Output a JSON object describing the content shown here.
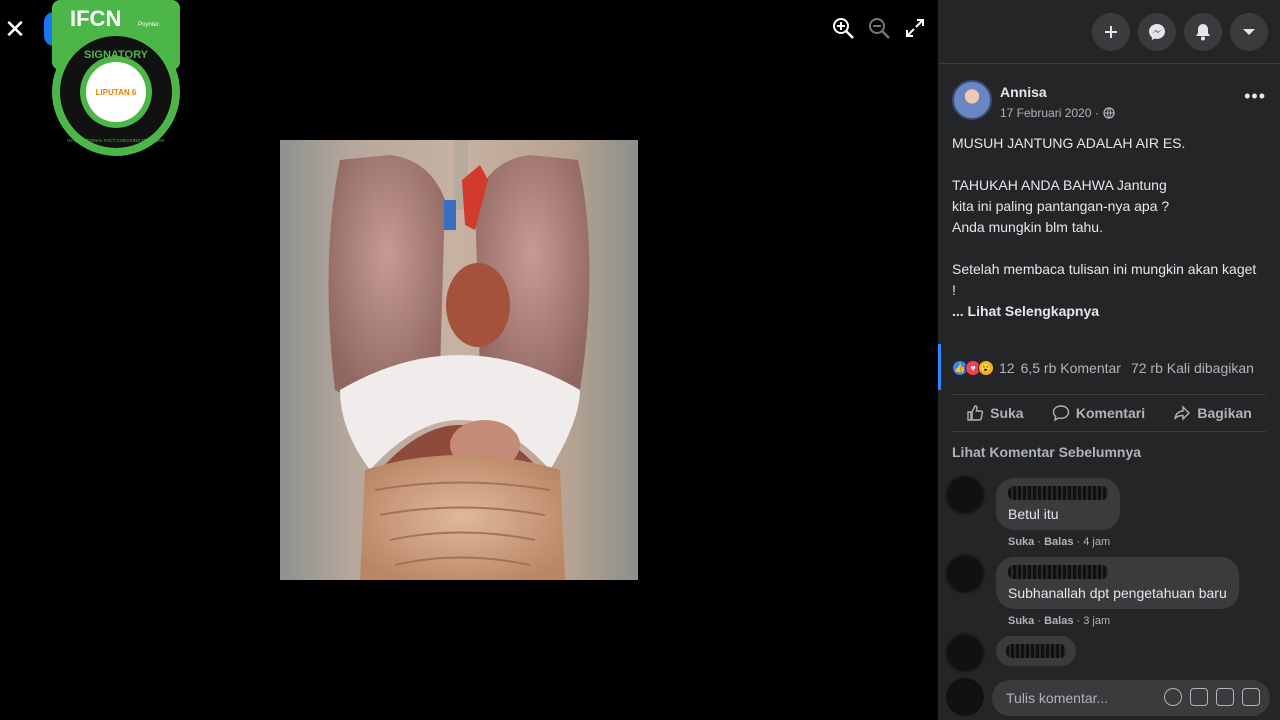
{
  "viewer": {
    "close_icon": "close-icon",
    "tools": [
      "zoom-in-icon",
      "zoom-out-icon",
      "fullscreen-icon"
    ]
  },
  "badge": {
    "org": "IFCN",
    "byline": "Poynter.",
    "signatory": "SIGNATORY",
    "network": "INTERNATIONAL FACT-CHECKING NETWORK",
    "partner": "LIPUTAN 6",
    "color": "#4cb748"
  },
  "topbar": {
    "icons": [
      "plus-icon",
      "messenger-icon",
      "bell-icon",
      "caret-down-icon"
    ]
  },
  "post": {
    "author": "Annisa",
    "date": "17 Februari 2020 ·",
    "privacy_icon": "globe-icon",
    "more": "•••",
    "lines": [
      "MUSUH JANTUNG ADALAH AIR ES.",
      "",
      "TAHUKAH ANDA BAHWA Jantung",
      "kita ini paling pantangan-nya apa ?",
      "Anda mungkin blm tahu.",
      "",
      "Setelah membaca tulisan ini mungkin akan kaget",
      "!"
    ],
    "see_more": "... Lihat Selengkapnya"
  },
  "stats": {
    "reaction_count": "12",
    "comments": "6,5 rb Komentar",
    "shares": "72 rb Kali dibagikan"
  },
  "actions": {
    "like": "Suka",
    "comment": "Komentari",
    "share": "Bagikan"
  },
  "prev_comments": "Lihat Komentar Sebelumnya",
  "comments": [
    {
      "text": "Betul itu",
      "like": "Suka",
      "reply": "Balas",
      "time": "4 jam"
    },
    {
      "text": "Subhanallah dpt pengetahuan baru",
      "like": "Suka",
      "reply": "Balas",
      "time": "3 jam"
    }
  ],
  "composer": {
    "placeholder": "Tulis komentar...",
    "icons": [
      "emoji-icon",
      "camera-icon",
      "gif-icon",
      "sticker-icon"
    ]
  }
}
